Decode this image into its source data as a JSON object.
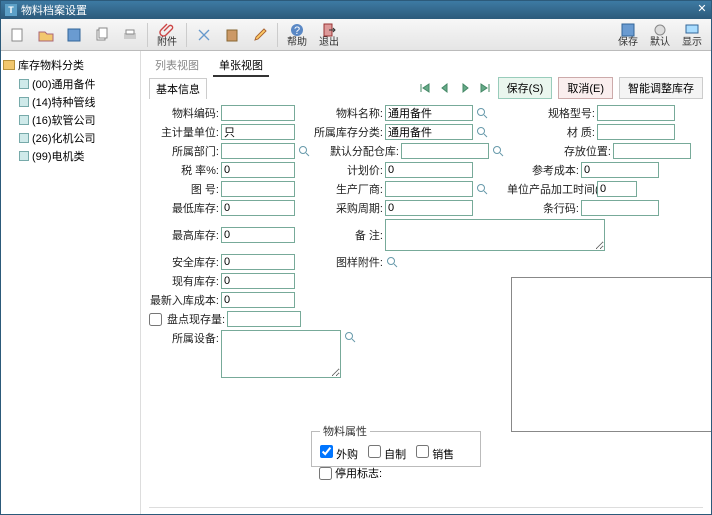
{
  "window": {
    "title": "物料档案设置"
  },
  "toolbar": {
    "attach": "附件",
    "help": "帮助",
    "exit": "退出",
    "save": "保存",
    "default": "默认",
    "display": "显示"
  },
  "tree": {
    "root": "库存物料分类",
    "items": [
      "(00)通用备件",
      "(14)特种管线",
      "(16)软管公司",
      "(26)化机公司",
      "(99)电机类"
    ]
  },
  "tabs": {
    "list": "列表视图",
    "single": "单张视图"
  },
  "subtabs": {
    "basic": "基本信息"
  },
  "actions": {
    "save": "保存(S)",
    "cancel": "取消(E)",
    "smart": "智能调整库存"
  },
  "labels": {
    "code": "物料编码:",
    "name": "物料名称:",
    "spec": "规格型号:",
    "unit": "主计量单位:",
    "cat": "所属库存分类:",
    "material": "材 质:",
    "dept": "所属部门:",
    "defstore": "默认分配仓库:",
    "loc": "存放位置:",
    "tax": "税 率%:",
    "plan": "计划价:",
    "refcost": "参考成本:",
    "drawno": "图 号:",
    "supplier": "生产厂商:",
    "proctime": "单位产品加工时间(时):",
    "minstock": "最低库存:",
    "cycle": "采购周期:",
    "barcode": "条行码:",
    "maxstock": "最高库存:",
    "remark": "备 注:",
    "safestock": "安全库存:",
    "attachimg": "图样附件:",
    "curstock": "现有库存:",
    "lastcost": "最新入库成本:",
    "inventory": "盘点现存量:",
    "equip": "所属设备:",
    "attrs": "物料属性",
    "a_out": "外购",
    "a_self": "自制",
    "a_sale": "销售",
    "deact": "停用标志:"
  },
  "values": {
    "code": "",
    "name": "通用备件",
    "unit": "只",
    "cat": "通用备件",
    "tax": "0",
    "plan": "0",
    "refcost": "0",
    "proctime": "0",
    "minstock": "0",
    "cycle": "0",
    "maxstock": "0",
    "safestock": "0",
    "curstock": "0",
    "lastcost": "0"
  }
}
